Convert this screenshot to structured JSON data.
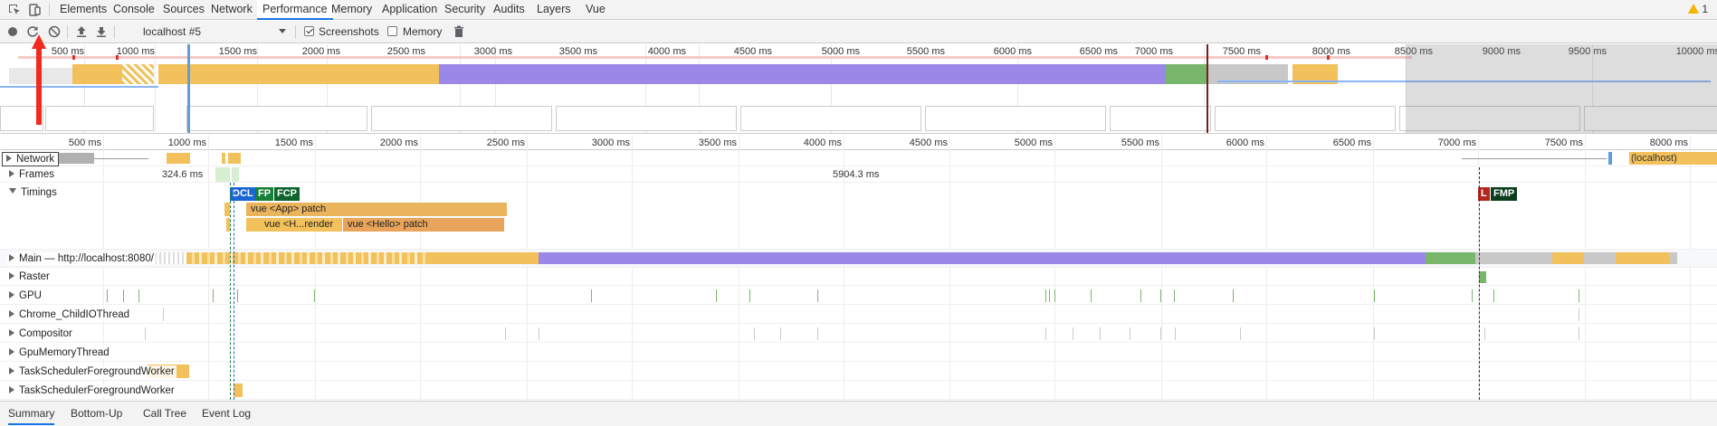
{
  "devtools_tabs": [
    "Elements",
    "Console",
    "Sources",
    "Network",
    "Performance",
    "Memory",
    "Application",
    "Security",
    "Audits",
    "Layers",
    "Vue"
  ],
  "active_tab": "Performance",
  "warning_count": "1",
  "toolbar": {
    "profile_select": "localhost #5",
    "screenshots_label": "Screenshots",
    "screenshots_checked": true,
    "memory_label": "Memory",
    "memory_checked": false
  },
  "overview_ticks": [
    "500 ms",
    "1000 ms",
    "1500 ms",
    "2000 ms",
    "2500 ms",
    "3000 ms",
    "3500 ms",
    "4000 ms",
    "4500 ms",
    "5000 ms",
    "5500 ms",
    "6000 ms",
    "6500 ms",
    "7000 ms",
    "7500 ms",
    "8000 ms",
    "8500 ms",
    "9000 ms",
    "9500 ms",
    "10000 ms"
  ],
  "ruler_ticks": [
    "500 ms",
    "1000 ms",
    "1500 ms",
    "2000 ms",
    "2500 ms",
    "3000 ms",
    "3500 ms",
    "4000 ms",
    "4500 ms",
    "5000 ms",
    "5500 ms",
    "6000 ms",
    "6500 ms",
    "7000 ms",
    "7500 ms",
    "8000 ms"
  ],
  "tracks": {
    "network": "Network",
    "frames": "Frames",
    "timings": "Timings",
    "main": "Main — http://localhost:8080/",
    "raster": "Raster",
    "gpu": "GPU",
    "chrome_child_io": "Chrome_ChildIOThread",
    "compositor": "Compositor",
    "gpu_memory": "GpuMemoryThread",
    "task_fg_1": "TaskSchedulerForegroundWorker",
    "task_fg_2": "TaskSchedulerForegroundWorker"
  },
  "network_request_label": "(localhost)",
  "frames": {
    "frame1": "324.6 ms",
    "frame2": "5904.3 ms"
  },
  "timing_markers": {
    "dcl": "DCL",
    "fp": "FP",
    "fcp": "FCP",
    "l": "L",
    "fmp": "FMP"
  },
  "timing_bars": {
    "app_patch": "vue <App> patch",
    "h_render": "vue <H...render",
    "hello_patch": "vue <Hello> patch"
  },
  "bottom_tabs": [
    "Summary",
    "Bottom-Up",
    "Call Tree",
    "Event Log"
  ],
  "active_bottom_tab": "Summary",
  "colors": {
    "scripting": "#f2c15b",
    "rendering": "#9b87e8",
    "painting": "#78b76b",
    "idle": "#c8c8c8",
    "dcl": "#1967d2",
    "fp": "#188038",
    "fcp": "#0d652d",
    "l": "#b3261e",
    "fmp": "#0b3d1e",
    "accent": "#1a73e8"
  }
}
